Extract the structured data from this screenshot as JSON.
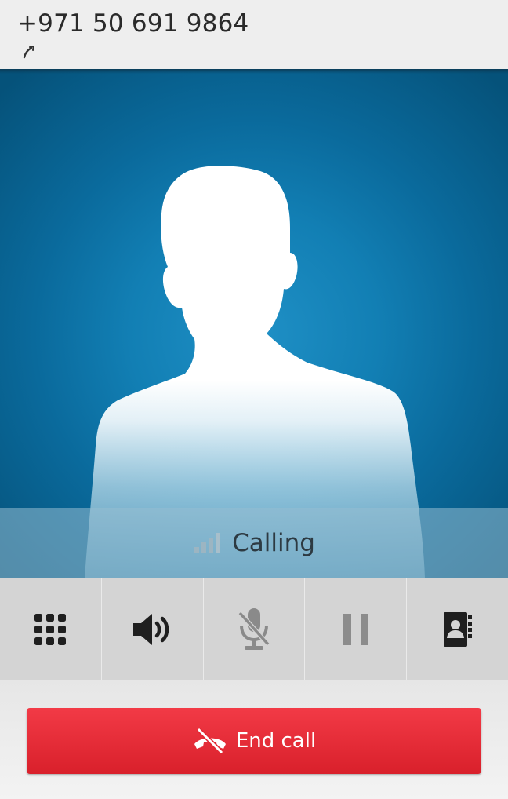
{
  "header": {
    "caller_number": "+971 50 691 9864",
    "call_type_icon": "outgoing-call-icon"
  },
  "contact_photo": {
    "placeholder": "person-silhouette",
    "background_color": "#127fb4"
  },
  "call_status": {
    "signal_icon": "signal-strength-icon",
    "label": "Calling"
  },
  "controls": [
    {
      "name": "dialpad",
      "icon": "dialpad-icon"
    },
    {
      "name": "speaker",
      "icon": "speaker-icon"
    },
    {
      "name": "mute",
      "icon": "microphone-muted-icon",
      "enabled": false
    },
    {
      "name": "hold",
      "icon": "pause-icon",
      "enabled": false
    },
    {
      "name": "contacts",
      "icon": "contacts-book-icon"
    }
  ],
  "end_call": {
    "label": "End call",
    "icon": "end-call-icon",
    "color": "#e52a35"
  }
}
